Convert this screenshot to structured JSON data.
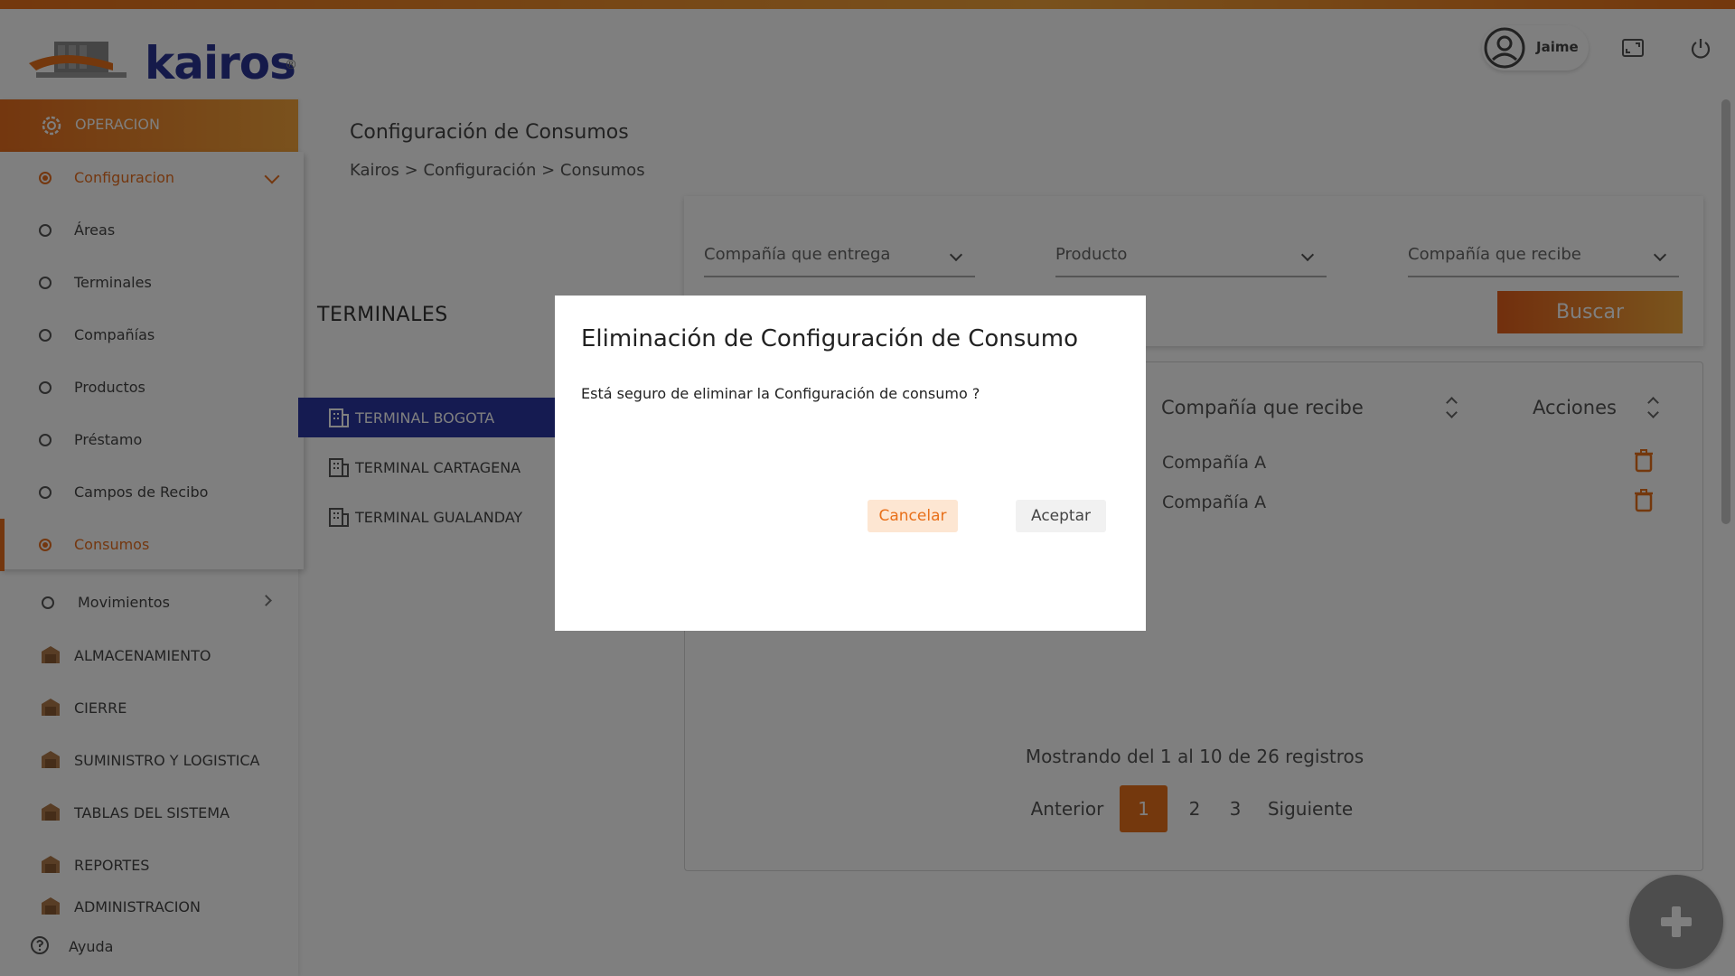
{
  "header": {
    "logo_text": "kairos",
    "logo_registered": "®",
    "user_name": "Jaime",
    "icons": [
      "user-avatar-icon",
      "fullscreen-icon",
      "power-icon"
    ]
  },
  "sidebar": {
    "operacion_label": "OPERACION",
    "configuracion_label": "Configuracion",
    "sub_items": [
      {
        "label": "Áreas"
      },
      {
        "label": "Terminales"
      },
      {
        "label": "Compañías"
      },
      {
        "label": "Productos"
      },
      {
        "label": "Préstamo"
      },
      {
        "label": "Campos de Recibo"
      },
      {
        "label": "Consumos"
      }
    ],
    "movimientos_label": "Movimientos",
    "main_items": [
      {
        "label": "ALMACENAMIENTO"
      },
      {
        "label": "CIERRE"
      },
      {
        "label": "SUMINISTRO Y LOGISTICA"
      },
      {
        "label": "TABLAS DEL SISTEMA"
      },
      {
        "label": "REPORTES"
      },
      {
        "label": "ADMINISTRACION"
      }
    ],
    "help_label": "Ayuda"
  },
  "page": {
    "title": "Configuración de Consumos",
    "breadcrumb": "Kairos > Configuración >  Consumos"
  },
  "terminals": {
    "title": "TERMINALES",
    "items": [
      {
        "label": "TERMINAL BOGOTA"
      },
      {
        "label": "TERMINAL CARTAGENA"
      },
      {
        "label": "TERMINAL GUALANDAY"
      }
    ]
  },
  "filters": {
    "company_delivers": "Compañía que entrega",
    "product": "Producto",
    "company_receives": "Compañía que recibe",
    "search_button": "Buscar"
  },
  "table": {
    "headers": {
      "company_receives": "Compañía que recibe",
      "actions": "Acciones"
    },
    "rows": [
      {
        "company_receives": "Compañía A"
      },
      {
        "company_receives": "Compañía A"
      }
    ],
    "paging_info": "Mostrando del 1 al 10 de 26 registros",
    "pagination": {
      "prev": "Anterior",
      "pages": [
        "1",
        "2",
        "3"
      ],
      "current": "1",
      "next": "Siguiente"
    }
  },
  "modal": {
    "title": "Eliminación de Configuración de Consumo",
    "message": "Está seguro de eliminar la Configuración de consumo ?",
    "cancel_label": "Cancelar",
    "accept_label": "Aceptar"
  },
  "colors": {
    "accent": "#e8701a",
    "brand_blue": "#2b36a3",
    "overlay": "rgba(0,0,0,0.5)"
  }
}
